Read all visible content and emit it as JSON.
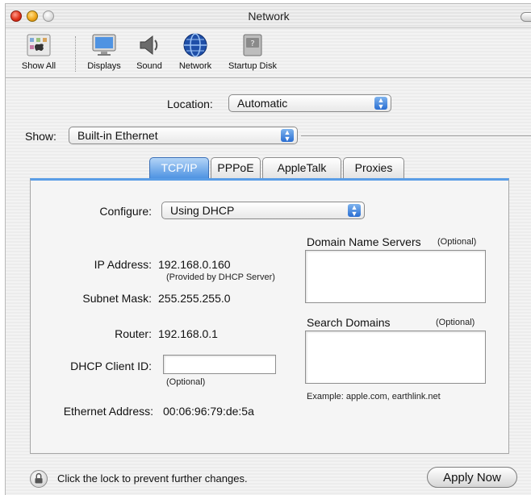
{
  "window": {
    "title": "Network"
  },
  "toolbar": {
    "items": [
      {
        "label": "Show All",
        "icon": "show-all-icon"
      },
      {
        "label": "Displays",
        "icon": "displays-icon"
      },
      {
        "label": "Sound",
        "icon": "sound-icon"
      },
      {
        "label": "Network",
        "icon": "network-icon"
      },
      {
        "label": "Startup Disk",
        "icon": "startup-disk-icon"
      }
    ]
  },
  "location": {
    "label": "Location:",
    "value": "Automatic"
  },
  "show": {
    "label": "Show:",
    "value": "Built-in Ethernet"
  },
  "tabs": [
    {
      "label": "TCP/IP",
      "active": true
    },
    {
      "label": "PPPoE",
      "active": false
    },
    {
      "label": "AppleTalk",
      "active": false
    },
    {
      "label": "Proxies",
      "active": false
    }
  ],
  "tcpip": {
    "configure_label": "Configure:",
    "configure_value": "Using DHCP",
    "ip_label": "IP Address:",
    "ip_value": "192.168.0.160",
    "ip_note": "(Provided by DHCP Server)",
    "subnet_label": "Subnet Mask:",
    "subnet_value": "255.255.255.0",
    "router_label": "Router:",
    "router_value": "192.168.0.1",
    "dhcp_client_label": "DHCP Client ID:",
    "dhcp_client_value": "",
    "dhcp_client_note": "(Optional)",
    "ethernet_label": "Ethernet Address:",
    "ethernet_value": "00:06:96:79:de:5a",
    "dns_label": "Domain Name Servers",
    "dns_optional": "(Optional)",
    "dns_value": "",
    "search_label": "Search Domains",
    "search_optional": "(Optional)",
    "search_value": "",
    "search_example": "Example: apple.com, earthlink.net"
  },
  "footer": {
    "lock_text": "Click the lock to prevent further changes.",
    "apply_label": "Apply Now"
  },
  "colors": {
    "accent": "#4f93e2",
    "tab_active_text": "#ffffff"
  }
}
